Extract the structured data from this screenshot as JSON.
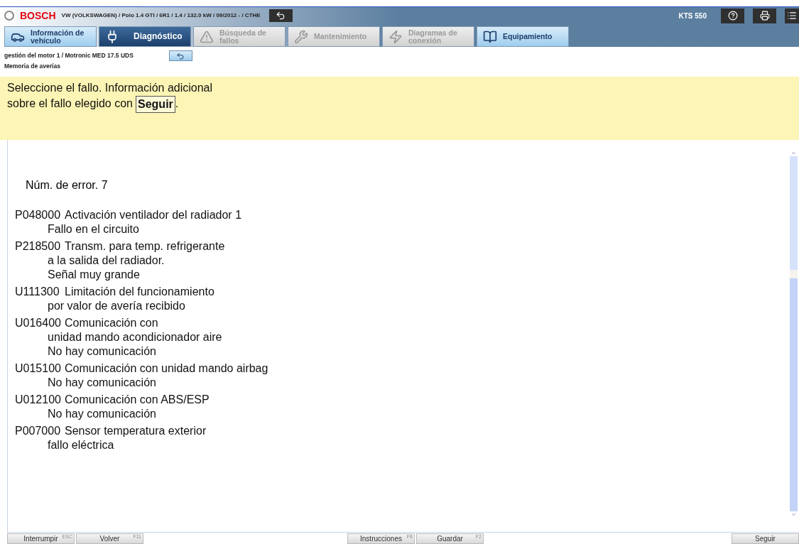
{
  "header": {
    "brand": "BOSCH",
    "vehicle": "VW (VOLKSWAGEN) / Polo 1.4 GTI / 6R1 / 1.4 / 132.0 kW / 09/2012 - / CTHE",
    "device": "KTS 550"
  },
  "tabs": [
    {
      "label": "Información de vehículo",
      "selected": false,
      "disabled": false
    },
    {
      "label": "Diagnóstico",
      "selected": true,
      "disabled": false
    },
    {
      "label": "Búsqueda de fallos",
      "selected": false,
      "disabled": true
    },
    {
      "label": "Mantenimiento",
      "selected": false,
      "disabled": true
    },
    {
      "label": "Diagramas de conexión",
      "selected": false,
      "disabled": true
    },
    {
      "label": "Equipamiento",
      "selected": false,
      "disabled": false
    }
  ],
  "breadcrumb": "gestión del motor 1 / Motronic MED 17.5 UDS",
  "section": "Memoria de averías",
  "instruction": {
    "line1": "Seleccione el fallo. Información adicional",
    "line2": "sobre el fallo elegido con",
    "button": "Seguir",
    "end": "."
  },
  "error_count": "Núm. de error. 7",
  "errors": [
    {
      "code": "P048000",
      "lines": [
        "Activación ventilador del radiador 1",
        "Fallo en el circuito"
      ]
    },
    {
      "code": "P218500",
      "lines": [
        "Transm. para temp. refrigerante",
        "a la salida del radiador.",
        "Señal muy grande"
      ]
    },
    {
      "code": "U111300",
      "lines": [
        "Limitación del funcionamiento",
        "por valor de avería recibido"
      ]
    },
    {
      "code": "U016400",
      "lines": [
        "Comunicación con",
        "unidad mando acondicionador aire",
        "No hay comunicación"
      ]
    },
    {
      "code": "U015100",
      "lines": [
        "Comunicación con unidad mando airbag",
        "No hay comunicación"
      ]
    },
    {
      "code": "U012100",
      "lines": [
        "Comunicación con ABS/ESP",
        "No hay comunicación"
      ]
    },
    {
      "code": "P007000",
      "lines": [
        "Sensor temperatura exterior",
        "fallo eléctrica"
      ]
    }
  ],
  "footer": {
    "left": [
      {
        "label": "Interrumpir",
        "key": "ESC"
      },
      {
        "label": "Volver",
        "key": "F11"
      }
    ],
    "center": [
      {
        "label": "Instrucciones",
        "key": "F8"
      },
      {
        "label": "Guardar",
        "key": "F2"
      }
    ],
    "right": [
      {
        "label": "Seguir"
      }
    ]
  }
}
